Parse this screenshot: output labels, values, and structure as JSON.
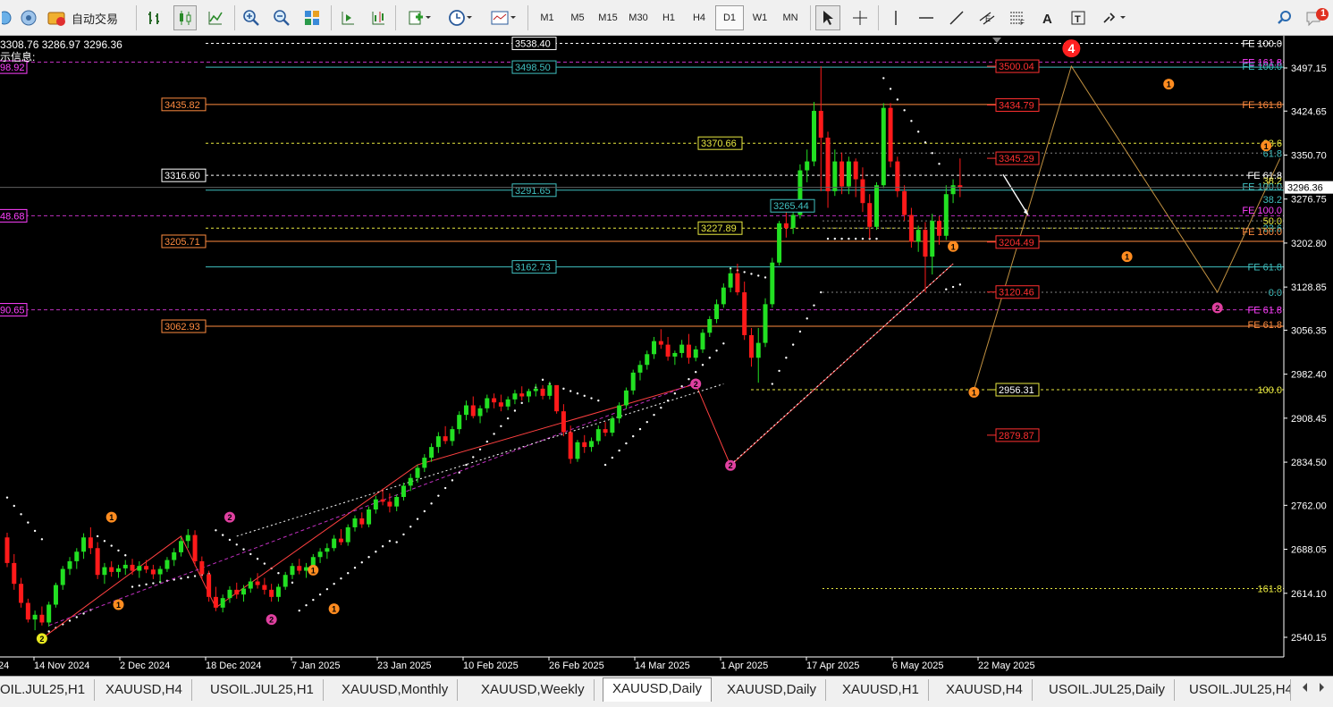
{
  "toolbar": {
    "auto_trade_label": "自动交易",
    "timeframes": [
      "M1",
      "M5",
      "M15",
      "M30",
      "H1",
      "H4",
      "D1",
      "W1",
      "MN"
    ],
    "active_timeframe": "D1",
    "notification_count": "1"
  },
  "chart_data": {
    "type": "candlestick",
    "info": {
      "ohlc_text": "3308.76 3286.97 3296.36",
      "indicator_text": "示信息:"
    },
    "price_axis": {
      "ticks": [
        3497.15,
        3424.65,
        3350.7,
        3276.75,
        3202.8,
        3128.85,
        3056.35,
        2982.4,
        2908.45,
        2834.5,
        2762.0,
        2688.05,
        2614.1,
        2540.15
      ],
      "current_price": "3296.36",
      "range": [
        2520,
        3560
      ]
    },
    "time_axis": [
      "24",
      "14 Nov 2024",
      "2 Dec 2024",
      "18 Dec 2024",
      "7 Jan 2025",
      "23 Jan 2025",
      "10 Feb 2025",
      "26 Feb 2025",
      "14 Mar 2025",
      "1 Apr 2025",
      "17 Apr 2025",
      "6 May 2025",
      "22 May 2025"
    ],
    "level_lines": [
      {
        "label": "3538.40",
        "value": 3538.4,
        "color": "#ffffff",
        "style": "dashed",
        "label_side": "left"
      },
      {
        "label": "3498.50",
        "value": 3498.5,
        "color": "#40c0c0",
        "style": "solid",
        "label_side": "left"
      },
      {
        "label": "3435.82",
        "value": 3435.82,
        "color": "#ff8c40",
        "style": "solid",
        "label_side": "left"
      },
      {
        "label": "3370.66",
        "value": 3370.66,
        "color": "#e8e840",
        "style": "dashed",
        "label_side": "left"
      },
      {
        "label": "3316.60",
        "value": 3316.6,
        "color": "#ffffff",
        "style": "dashed",
        "label_side": "left"
      },
      {
        "label": "3291.65",
        "value": 3291.65,
        "color": "#40c0c0",
        "style": "solid",
        "label_side": "left"
      },
      {
        "label": "3265.44",
        "value": 3265.44,
        "color": "#40c0c0",
        "style": "none",
        "label_side": "left"
      },
      {
        "label": "3227.89",
        "value": 3227.89,
        "color": "#e8e840",
        "style": "dashed",
        "label_side": "left"
      },
      {
        "label": "3205.71",
        "value": 3205.71,
        "color": "#ff8c40",
        "style": "solid",
        "label_side": "left"
      },
      {
        "label": "3162.73",
        "value": 3162.73,
        "color": "#40c0c0",
        "style": "solid",
        "label_side": "left"
      },
      {
        "label": "3062.93",
        "value": 3062.93,
        "color": "#ff8c40",
        "style": "solid",
        "label_side": "left"
      },
      {
        "label": "3500.04",
        "value": 3500.04,
        "color": "#ff3030",
        "style": "none",
        "label_side": "right"
      },
      {
        "label": "3434.79",
        "value": 3434.79,
        "color": "#ff3030",
        "style": "none",
        "label_side": "right"
      },
      {
        "label": "3345.29",
        "value": 3345.29,
        "color": "#ff3030",
        "style": "none",
        "label_side": "right"
      },
      {
        "label": "3204.49",
        "value": 3204.49,
        "color": "#ff3030",
        "style": "none",
        "label_side": "right"
      },
      {
        "label": "3120.46",
        "value": 3120.46,
        "color": "#ff3030",
        "style": "none",
        "label_side": "right"
      },
      {
        "label": "2956.31",
        "value": 2956.31,
        "color": "#e8e840",
        "style": "dashed",
        "label_side": "right"
      },
      {
        "label": "2879.87",
        "value": 2879.87,
        "color": "#ff3030",
        "style": "none",
        "label_side": "right"
      }
    ],
    "left_clipped_labels": [
      {
        "label": "98.92",
        "value": 3498.5,
        "color": "#ff40ff"
      },
      {
        "label": "48.68",
        "value": 3248.68,
        "color": "#ff40ff"
      },
      {
        "label": "90.65",
        "value": 3090.65,
        "color": "#ff40ff"
      }
    ],
    "fib_labels": [
      {
        "label": "FE 100.0",
        "value": 3538.4,
        "color": "#ffffff"
      },
      {
        "label": "FE 161.8",
        "value": 3507.0,
        "color": "#ff40ff"
      },
      {
        "label": "FE 100.0",
        "value": 3500.0,
        "color": "#40c0c0"
      },
      {
        "label": "FE 161.8",
        "value": 3435.82,
        "color": "#ff8c40"
      },
      {
        "label": "23.6",
        "value": 3370.66,
        "color": "#e8e840"
      },
      {
        "label": "61.8",
        "value": 3354.0,
        "color": "#40c0c0"
      },
      {
        "label": "FE 61.8",
        "value": 3316.6,
        "color": "#ffffff"
      },
      {
        "label": "38.2",
        "value": 3308.0,
        "color": "#e8e840"
      },
      {
        "label": "FE 100.0",
        "value": 3298.0,
        "color": "#40c0c0"
      },
      {
        "label": "38.2",
        "value": 3276.0,
        "color": "#40c0c0"
      },
      {
        "label": "FE 100.0",
        "value": 3258.0,
        "color": "#ff40ff"
      },
      {
        "label": "50.0",
        "value": 3240.0,
        "color": "#e8e840"
      },
      {
        "label": "23.6",
        "value": 3228.0,
        "color": "#40c0c0"
      },
      {
        "label": "FE 100.0",
        "value": 3222.0,
        "color": "#ff8c40"
      },
      {
        "label": "FE 61.8",
        "value": 3162.73,
        "color": "#40c0c0"
      },
      {
        "label": "0.0",
        "value": 3120.0,
        "color": "#40c0c0"
      },
      {
        "label": "FE 61.8",
        "value": 3090.65,
        "color": "#ff40ff"
      },
      {
        "label": "FE 61.8",
        "value": 3066.0,
        "color": "#ff8c40"
      },
      {
        "label": "100.0",
        "value": 2956.31,
        "color": "#e8e840"
      },
      {
        "label": "161.8",
        "value": 2622.0,
        "color": "#e8e840"
      }
    ],
    "wave_labels": [
      {
        "label": "4",
        "bar": 153,
        "value": 3530,
        "color": "#ff2020",
        "big": true
      },
      {
        "label": "1",
        "bar": 167,
        "value": 3470,
        "color": "#ff8c20"
      },
      {
        "label": "1",
        "bar": 181,
        "value": 3366,
        "color": "#ff8c20"
      },
      {
        "label": "1",
        "bar": 161,
        "value": 3180,
        "color": "#ff8c20"
      },
      {
        "label": "2",
        "bar": 174,
        "value": 3094,
        "color": "#e040a0"
      },
      {
        "label": "1",
        "bar": 136,
        "value": 3197,
        "color": "#ff8c20"
      },
      {
        "label": "1",
        "bar": 139,
        "value": 2952,
        "color": "#ff8c20"
      },
      {
        "label": "2",
        "bar": 99,
        "value": 2966,
        "color": "#e040a0"
      },
      {
        "label": "2",
        "bar": 104,
        "value": 2829,
        "color": "#e040a0"
      },
      {
        "label": "1",
        "bar": 15,
        "value": 2742,
        "color": "#ff8c20"
      },
      {
        "label": "2",
        "bar": 32,
        "value": 2742,
        "color": "#e040a0"
      },
      {
        "label": "1",
        "bar": 44,
        "value": 2653,
        "color": "#ff8c20"
      },
      {
        "label": "1",
        "bar": 16,
        "value": 2595,
        "color": "#ff8c20"
      },
      {
        "label": "1",
        "bar": 47,
        "value": 2588,
        "color": "#ff8c20"
      },
      {
        "label": "2",
        "bar": 38,
        "value": 2570,
        "color": "#e040a0"
      },
      {
        "label": "2",
        "bar": 5,
        "value": 2538,
        "color": "#e8e820"
      }
    ],
    "candles": [
      [
        2708,
        2716,
        2658,
        2665
      ],
      [
        2665,
        2680,
        2620,
        2630
      ],
      [
        2630,
        2640,
        2590,
        2598
      ],
      [
        2598,
        2605,
        2565,
        2570
      ],
      [
        2570,
        2585,
        2552,
        2578
      ],
      [
        2578,
        2592,
        2560,
        2565
      ],
      [
        2565,
        2600,
        2558,
        2595
      ],
      [
        2595,
        2632,
        2590,
        2628
      ],
      [
        2628,
        2660,
        2620,
        2655
      ],
      [
        2655,
        2675,
        2645,
        2668
      ],
      [
        2668,
        2690,
        2655,
        2684
      ],
      [
        2684,
        2715,
        2672,
        2708
      ],
      [
        2708,
        2725,
        2680,
        2690
      ],
      [
        2690,
        2700,
        2638,
        2645
      ],
      [
        2645,
        2665,
        2630,
        2658
      ],
      [
        2658,
        2668,
        2642,
        2650
      ],
      [
        2650,
        2662,
        2640,
        2656
      ],
      [
        2656,
        2670,
        2645,
        2662
      ],
      [
        2662,
        2672,
        2645,
        2652
      ],
      [
        2652,
        2668,
        2640,
        2660
      ],
      [
        2660,
        2670,
        2648,
        2654
      ],
      [
        2654,
        2662,
        2638,
        2646
      ],
      [
        2646,
        2660,
        2632,
        2655
      ],
      [
        2655,
        2675,
        2650,
        2670
      ],
      [
        2670,
        2690,
        2660,
        2683
      ],
      [
        2683,
        2708,
        2676,
        2702
      ],
      [
        2702,
        2722,
        2690,
        2712
      ],
      [
        2712,
        2720,
        2660,
        2668
      ],
      [
        2668,
        2676,
        2638,
        2646
      ],
      [
        2646,
        2652,
        2600,
        2608
      ],
      [
        2608,
        2625,
        2584,
        2590
      ],
      [
        2590,
        2612,
        2582,
        2606
      ],
      [
        2606,
        2626,
        2598,
        2620
      ],
      [
        2620,
        2632,
        2605,
        2612
      ],
      [
        2612,
        2628,
        2600,
        2622
      ],
      [
        2622,
        2640,
        2615,
        2634
      ],
      [
        2634,
        2648,
        2622,
        2628
      ],
      [
        2628,
        2640,
        2612,
        2620
      ],
      [
        2620,
        2630,
        2600,
        2608
      ],
      [
        2608,
        2630,
        2600,
        2625
      ],
      [
        2625,
        2650,
        2620,
        2645
      ],
      [
        2645,
        2665,
        2638,
        2660
      ],
      [
        2660,
        2672,
        2646,
        2652
      ],
      [
        2652,
        2665,
        2640,
        2658
      ],
      [
        2658,
        2680,
        2652,
        2675
      ],
      [
        2675,
        2690,
        2665,
        2684
      ],
      [
        2684,
        2698,
        2672,
        2690
      ],
      [
        2690,
        2712,
        2685,
        2706
      ],
      [
        2706,
        2722,
        2695,
        2700
      ],
      [
        2700,
        2730,
        2694,
        2725
      ],
      [
        2725,
        2745,
        2718,
        2740
      ],
      [
        2740,
        2750,
        2724,
        2730
      ],
      [
        2730,
        2760,
        2725,
        2755
      ],
      [
        2755,
        2778,
        2748,
        2772
      ],
      [
        2772,
        2790,
        2762,
        2768
      ],
      [
        2768,
        2782,
        2750,
        2760
      ],
      [
        2760,
        2780,
        2752,
        2776
      ],
      [
        2776,
        2800,
        2770,
        2795
      ],
      [
        2795,
        2815,
        2786,
        2808
      ],
      [
        2808,
        2830,
        2800,
        2825
      ],
      [
        2825,
        2848,
        2818,
        2842
      ],
      [
        2842,
        2866,
        2835,
        2860
      ],
      [
        2860,
        2885,
        2850,
        2878
      ],
      [
        2878,
        2895,
        2865,
        2870
      ],
      [
        2870,
        2895,
        2862,
        2890
      ],
      [
        2890,
        2920,
        2882,
        2914
      ],
      [
        2914,
        2938,
        2905,
        2930
      ],
      [
        2930,
        2945,
        2908,
        2912
      ],
      [
        2912,
        2930,
        2900,
        2925
      ],
      [
        2925,
        2948,
        2918,
        2942
      ],
      [
        2942,
        2950,
        2925,
        2935
      ],
      [
        2935,
        2948,
        2920,
        2928
      ],
      [
        2928,
        2945,
        2922,
        2940
      ],
      [
        2940,
        2956,
        2932,
        2950
      ],
      [
        2950,
        2962,
        2938,
        2945
      ],
      [
        2945,
        2958,
        2935,
        2954
      ],
      [
        2954,
        2966,
        2945,
        2958
      ],
      [
        2958,
        2964,
        2940,
        2946
      ],
      [
        2946,
        2970,
        2940,
        2964
      ],
      [
        2964,
        2958,
        2916,
        2920
      ],
      [
        2920,
        2932,
        2878,
        2885
      ],
      [
        2885,
        2896,
        2832,
        2840
      ],
      [
        2840,
        2872,
        2835,
        2868
      ],
      [
        2868,
        2880,
        2850,
        2860
      ],
      [
        2860,
        2876,
        2852,
        2870
      ],
      [
        2870,
        2896,
        2864,
        2890
      ],
      [
        2890,
        2902,
        2878,
        2884
      ],
      [
        2884,
        2912,
        2878,
        2908
      ],
      [
        2908,
        2935,
        2900,
        2930
      ],
      [
        2930,
        2960,
        2924,
        2955
      ],
      [
        2955,
        2990,
        2948,
        2985
      ],
      [
        2985,
        3005,
        2972,
        2998
      ],
      [
        2998,
        3022,
        2990,
        3016
      ],
      [
        3016,
        3045,
        3008,
        3038
      ],
      [
        3038,
        3058,
        3025,
        3032
      ],
      [
        3032,
        3045,
        3005,
        3012
      ],
      [
        3012,
        3022,
        2998,
        3018
      ],
      [
        3018,
        3040,
        3010,
        3032
      ],
      [
        3032,
        3050,
        3000,
        3010
      ],
      [
        3010,
        3030,
        3004,
        3024
      ],
      [
        3024,
        3058,
        3018,
        3052
      ],
      [
        3052,
        3080,
        3045,
        3075
      ],
      [
        3075,
        3108,
        3068,
        3100
      ],
      [
        3100,
        3135,
        3094,
        3128
      ],
      [
        3128,
        3160,
        3120,
        3152
      ],
      [
        3152,
        3168,
        3115,
        3120
      ],
      [
        3120,
        3138,
        3040,
        3048
      ],
      [
        3048,
        3060,
        2995,
        3010
      ],
      [
        3010,
        3060,
        2968,
        3035
      ],
      [
        3035,
        3110,
        3028,
        3100
      ],
      [
        3100,
        3178,
        3094,
        3170
      ],
      [
        3170,
        3240,
        3165,
        3236
      ],
      [
        3236,
        3255,
        3212,
        3228
      ],
      [
        3228,
        3260,
        3218,
        3250
      ],
      [
        3250,
        3335,
        3244,
        3325
      ],
      [
        3325,
        3360,
        3305,
        3340
      ],
      [
        3340,
        3440,
        3332,
        3425
      ],
      [
        3425,
        3500,
        3290,
        3380
      ],
      [
        3380,
        3390,
        3262,
        3290
      ],
      [
        3290,
        3360,
        3282,
        3340
      ],
      [
        3340,
        3355,
        3285,
        3298
      ],
      [
        3298,
        3348,
        3285,
        3340
      ],
      [
        3340,
        3345,
        3280,
        3310
      ],
      [
        3310,
        3330,
        3255,
        3270
      ],
      [
        3270,
        3285,
        3210,
        3230
      ],
      [
        3230,
        3305,
        3225,
        3300
      ],
      [
        3300,
        3438,
        3295,
        3430
      ],
      [
        3430,
        3438,
        3330,
        3340
      ],
      [
        3340,
        3348,
        3280,
        3290
      ],
      [
        3290,
        3300,
        3240,
        3250
      ],
      [
        3250,
        3262,
        3195,
        3205
      ],
      [
        3205,
        3232,
        3188,
        3225
      ],
      [
        3225,
        3238,
        3120,
        3180
      ],
      [
        3180,
        3252,
        3150,
        3240
      ],
      [
        3240,
        3248,
        3200,
        3215
      ],
      [
        3215,
        3300,
        3208,
        3285
      ],
      [
        3285,
        3310,
        3270,
        3300
      ],
      [
        3300,
        3345,
        3280,
        3296
      ]
    ],
    "indicators": [
      "parabolic_sar",
      "zigzag",
      "fibonacci_retracements",
      "fibonacci_expansions"
    ]
  },
  "tabs": [
    "OIL.JUL25,H1",
    "XAUUSD,H4",
    "USOIL.JUL25,H1",
    "XAUUSD,Monthly",
    "XAUUSD,Weekly",
    "XAUUSD,Daily",
    "XAUUSD,Daily",
    "XAUUSD,H1",
    "XAUUSD,H4",
    "USOIL.JUL25,Daily",
    "USOIL.JUL25,H4"
  ],
  "active_tab": "XAUUSD,Daily"
}
